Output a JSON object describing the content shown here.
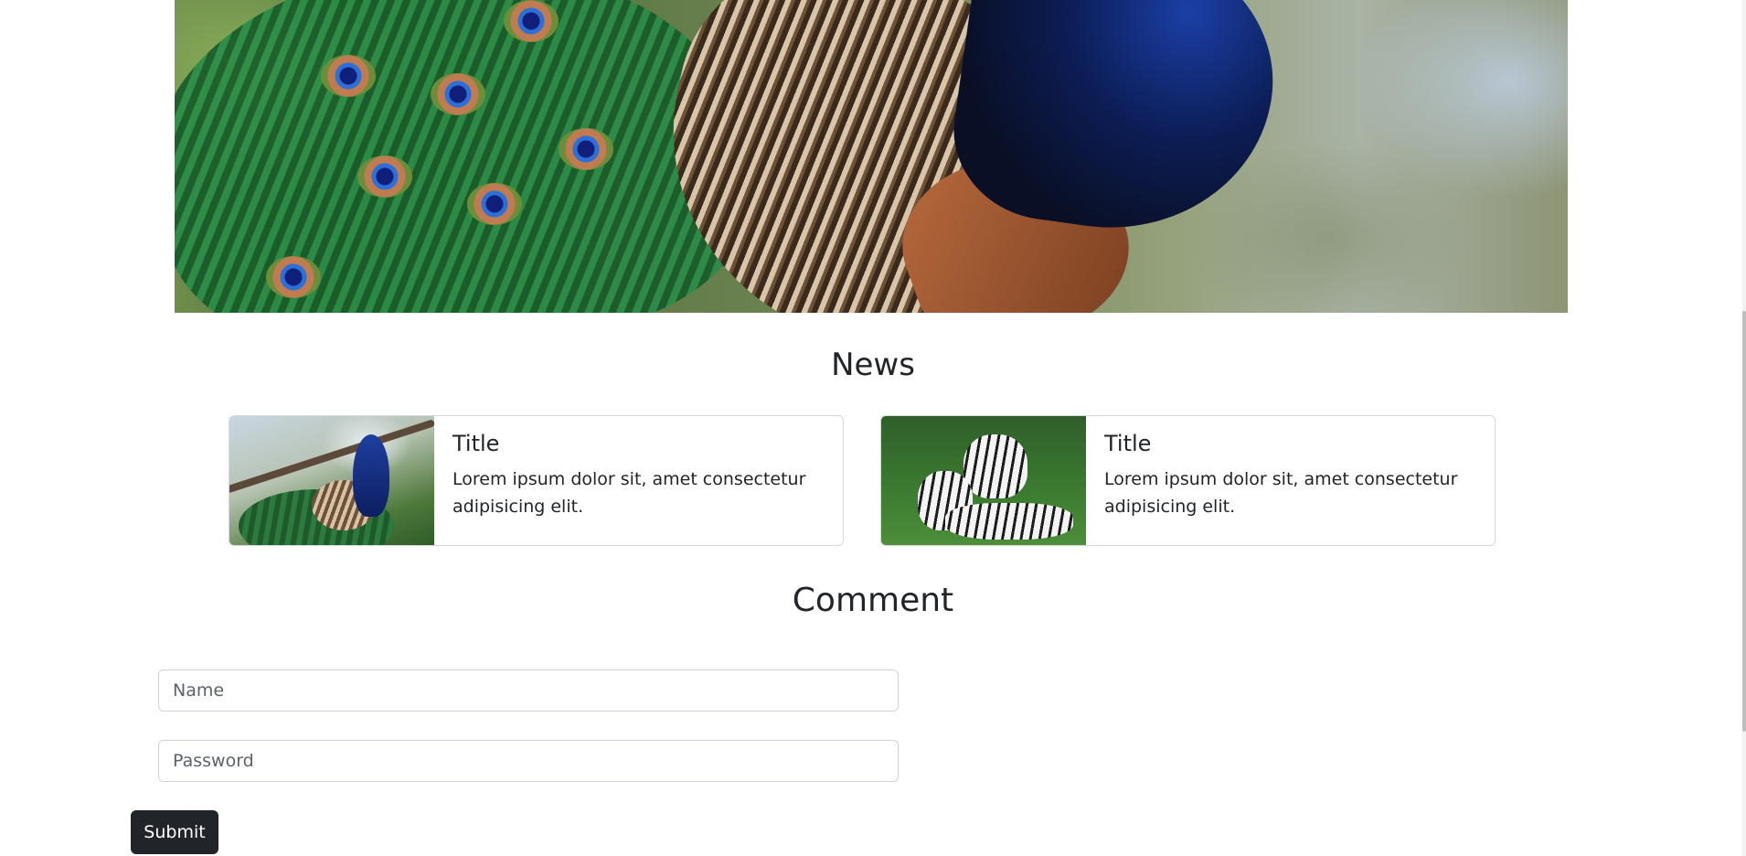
{
  "hero": {
    "image": "peacock-closeup-photo"
  },
  "news": {
    "heading": "News",
    "cards": [
      {
        "image": "peacock-thumbnail-photo",
        "title": "Title",
        "text": "Lorem ipsum dolor sit, amet consectetur adipisicing elit."
      },
      {
        "image": "white-tigers-thumbnail-photo",
        "title": "Title",
        "text": "Lorem ipsum dolor sit, amet consectetur adipisicing elit."
      }
    ]
  },
  "comment": {
    "heading": "Comment",
    "name_placeholder": "Name",
    "password_placeholder": "Password",
    "submit_label": "Submit"
  },
  "colors": {
    "button_bg": "#212529",
    "text": "#212529",
    "border": "#ced4da"
  }
}
